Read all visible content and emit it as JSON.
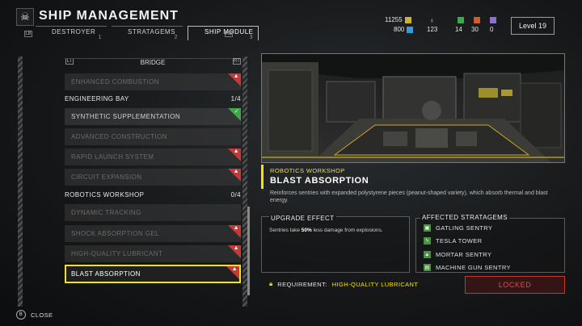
{
  "header": {
    "title": "SHIP MANAGEMENT",
    "logo_icon": "skull-icon",
    "tabs": [
      {
        "label": "DESTROYER",
        "num": "1",
        "active": false
      },
      {
        "label": "STRATAGEMS",
        "num": "2",
        "active": false
      },
      {
        "label": "SHIP MODULE",
        "num": "3",
        "active": true
      }
    ],
    "tab_key_left": "LB",
    "tab_key_right": "RB"
  },
  "resources": {
    "requisition": "11255",
    "super_credits": "800",
    "medals": "123",
    "common": "14",
    "rare": "30",
    "super_rare": "0",
    "level": "Level 19",
    "colors": {
      "requisition": "#c9b23a",
      "credits": "#3b9ad9",
      "medals": "#e0c84a",
      "common": "#3fa64a",
      "rare": "#d05a2e",
      "super_rare": "#8b6fd1"
    }
  },
  "list": {
    "header": "BRIDGE",
    "key_left": "LT",
    "key_right": "RT",
    "bridge_items": [
      {
        "label": "ENHANCED COMBUSTION",
        "dim": true,
        "badge": "red"
      }
    ],
    "engineering": {
      "label": "ENGINEERING BAY",
      "count": "1/4"
    },
    "engineering_items": [
      {
        "label": "SYNTHETIC SUPPLEMENTATION",
        "dim": false,
        "badge": "green"
      },
      {
        "label": "ADVANCED CONSTRUCTION",
        "dim": true,
        "badge": ""
      },
      {
        "label": "RAPID LAUNCH SYSTEM",
        "dim": true,
        "badge": "red"
      },
      {
        "label": "CIRCUIT EXPANSION",
        "dim": true,
        "badge": "red"
      }
    ],
    "robotics": {
      "label": "ROBOTICS WORKSHOP",
      "count": "0/4"
    },
    "robotics_items": [
      {
        "label": "DYNAMIC TRACKING",
        "dim": true,
        "badge": ""
      },
      {
        "label": "SHOCK ABSORPTION GEL",
        "dim": true,
        "badge": "red"
      },
      {
        "label": "HIGH-QUALITY LUBRICANT",
        "dim": true,
        "badge": "red"
      },
      {
        "label": "BLAST ABSORPTION",
        "dim": false,
        "badge": "red",
        "selected": true
      }
    ]
  },
  "detail": {
    "category": "ROBOTICS WORKSHOP",
    "title": "BLAST ABSORPTION",
    "description": "Reinforces sentries with expanded polystyrene pieces (peanut-shaped variety), which absorb thermal and blast energy.",
    "effect_heading": "UPGRADE EFFECT",
    "effect_text_pre": "Sentries take ",
    "effect_text_bold": "50%",
    "effect_text_post": " less damage from explosions.",
    "affected_heading": "AFFECTED STRATAGEMS",
    "affected": [
      "GATLING SENTRY",
      "TESLA TOWER",
      "MORTAR SENTRY",
      "MACHINE GUN SENTRY"
    ],
    "requirement_label": "REQUIREMENT:",
    "requirement_value": "HIGH-QUALITY LUBRICANT",
    "button_label": "LOCKED"
  },
  "footer": {
    "close_label": "CLOSE",
    "close_key": "B"
  }
}
